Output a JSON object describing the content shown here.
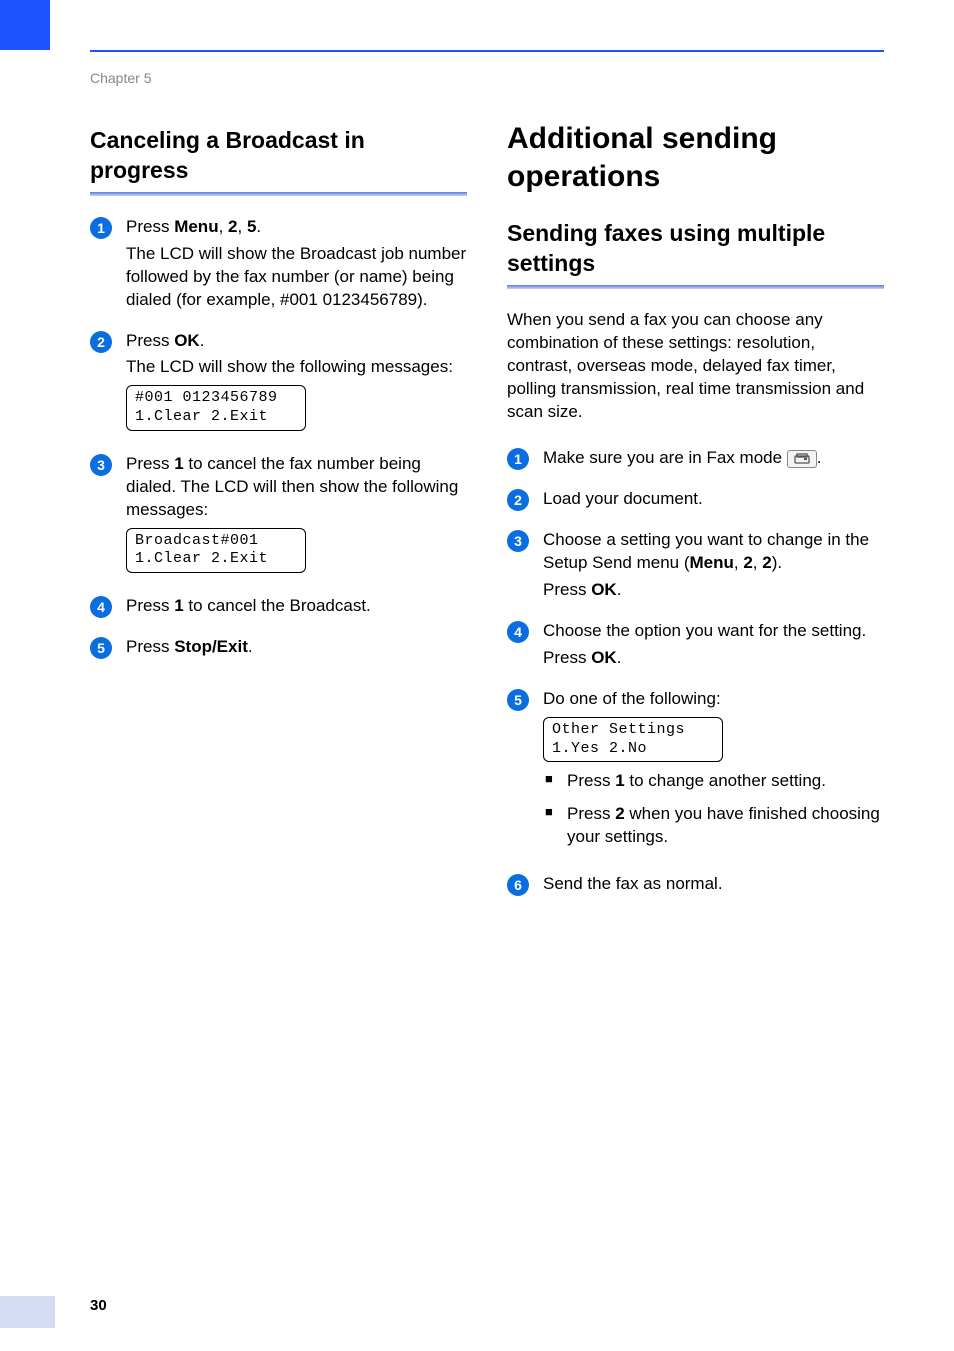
{
  "chapter": "Chapter 5",
  "page_number": "30",
  "left": {
    "title": "Canceling a Broadcast in progress",
    "steps": {
      "s1": {
        "num": "1",
        "l1a": "Press ",
        "l1b": "Menu",
        "l1c": ", ",
        "l1d": "2",
        "l1e": ", ",
        "l1f": "5",
        "l1g": ".",
        "l2": "The LCD will show the Broadcast job number followed by the fax number (or name) being dialed (for example, #001 0123456789)."
      },
      "s2": {
        "num": "2",
        "l1a": "Press ",
        "l1b": "OK",
        "l1c": ".",
        "l2": "The LCD will show the following messages:",
        "lcd1": "#001 0123456789",
        "lcd2": "1.Clear  2.Exit"
      },
      "s3": {
        "num": "3",
        "l1a": "Press ",
        "l1b": "1",
        "l1c": " to cancel the fax number being dialed. The LCD will then show the following messages:",
        "lcd1": "Broadcast#001",
        "lcd2": "1.Clear  2.Exit"
      },
      "s4": {
        "num": "4",
        "l1a": "Press ",
        "l1b": "1",
        "l1c": " to cancel the Broadcast."
      },
      "s5": {
        "num": "5",
        "l1a": "Press ",
        "l1b": "Stop/Exit",
        "l1c": "."
      }
    }
  },
  "right": {
    "title_main": "Additional sending operations",
    "title_sub": "Sending faxes using multiple settings",
    "intro": "When you send a fax you can choose any combination of these settings: resolution, contrast, overseas mode, delayed fax timer, polling transmission, real time transmission and scan size.",
    "steps": {
      "s1": {
        "num": "1",
        "l1": "Make sure you are in Fax mode ",
        "l1end": "."
      },
      "s2": {
        "num": "2",
        "l1": "Load your document."
      },
      "s3": {
        "num": "3",
        "l1a": "Choose a setting you want to change in the Setup Send menu (",
        "l1b": "Menu",
        "l1c": ", ",
        "l1d": "2",
        "l1e": ", ",
        "l1f": "2",
        "l1g": ").",
        "l2a": "Press ",
        "l2b": "OK",
        "l2c": "."
      },
      "s4": {
        "num": "4",
        "l1": "Choose the option you want for the setting.",
        "l2a": "Press ",
        "l2b": "OK",
        "l2c": "."
      },
      "s5": {
        "num": "5",
        "l1": "Do one of the following:",
        "lcd1": "Other Settings",
        "lcd2": "1.Yes 2.No",
        "b1a": "Press ",
        "b1b": "1",
        "b1c": " to change another setting.",
        "b2a": "Press ",
        "b2b": "2",
        "b2c": " when you have finished choosing your settings."
      },
      "s6": {
        "num": "6",
        "l1": "Send the fax as normal."
      }
    }
  }
}
